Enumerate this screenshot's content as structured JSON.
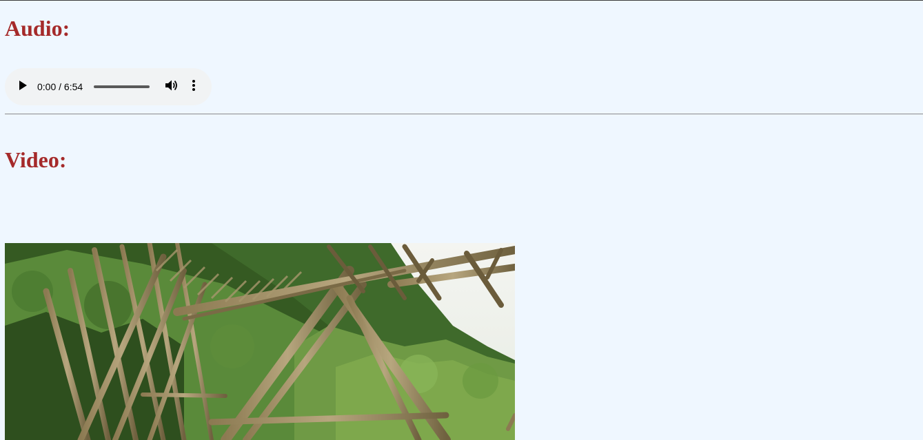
{
  "sections": {
    "audio": {
      "heading": "Audio:"
    },
    "video": {
      "heading": "Video:"
    }
  },
  "audio_player": {
    "time_display": "0:00 / 6:54",
    "current_time": "0:00",
    "duration": "6:54",
    "progress_fraction": 0,
    "controls": {
      "play_icon": "play-icon",
      "volume_icon": "volume-icon",
      "menu_icon": "more-vert-icon"
    }
  },
  "video_poster": {
    "subject": "bamboo scaffolding structure in front of trees"
  },
  "colors": {
    "page_background": "#eff7ff",
    "heading": "#a52a2a",
    "player_background": "#f1f3f4"
  }
}
